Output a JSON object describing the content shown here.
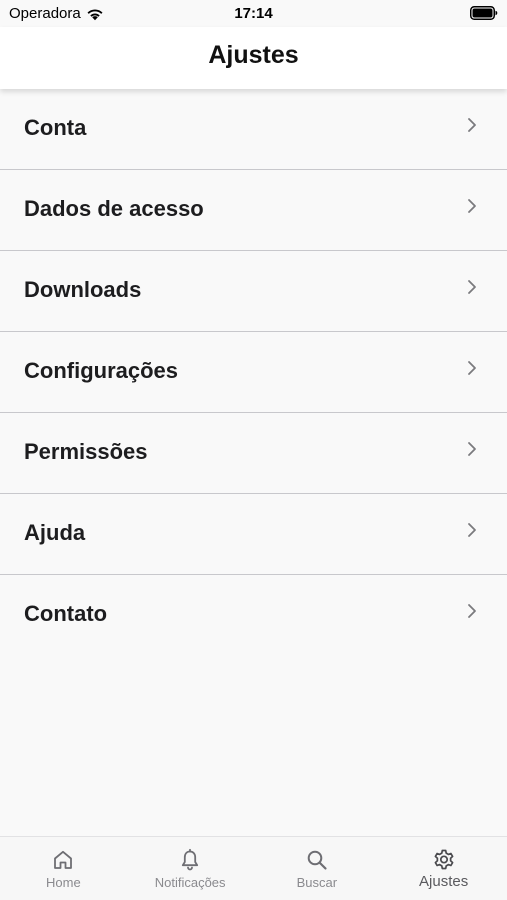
{
  "status_bar": {
    "carrier": "Operadora",
    "time": "17:14"
  },
  "header": {
    "title": "Ajustes"
  },
  "settings": {
    "items": [
      {
        "label": "Conta"
      },
      {
        "label": "Dados de acesso"
      },
      {
        "label": "Downloads"
      },
      {
        "label": "Configurações"
      },
      {
        "label": "Permissões"
      },
      {
        "label": "Ajuda"
      },
      {
        "label": "Contato"
      }
    ]
  },
  "tab_bar": {
    "tabs": [
      {
        "label": "Home",
        "icon": "home-icon"
      },
      {
        "label": "Notificações",
        "icon": "bell-icon"
      },
      {
        "label": "Buscar",
        "icon": "search-icon"
      },
      {
        "label": "Ajustes",
        "icon": "gear-icon",
        "active": true
      }
    ]
  },
  "colors": {
    "background": "#f9f9f9",
    "header_background": "#ffffff",
    "separator": "#c8c8cc",
    "tab_inactive": "#8a8a8e",
    "tab_active": "#5a5a5e"
  }
}
